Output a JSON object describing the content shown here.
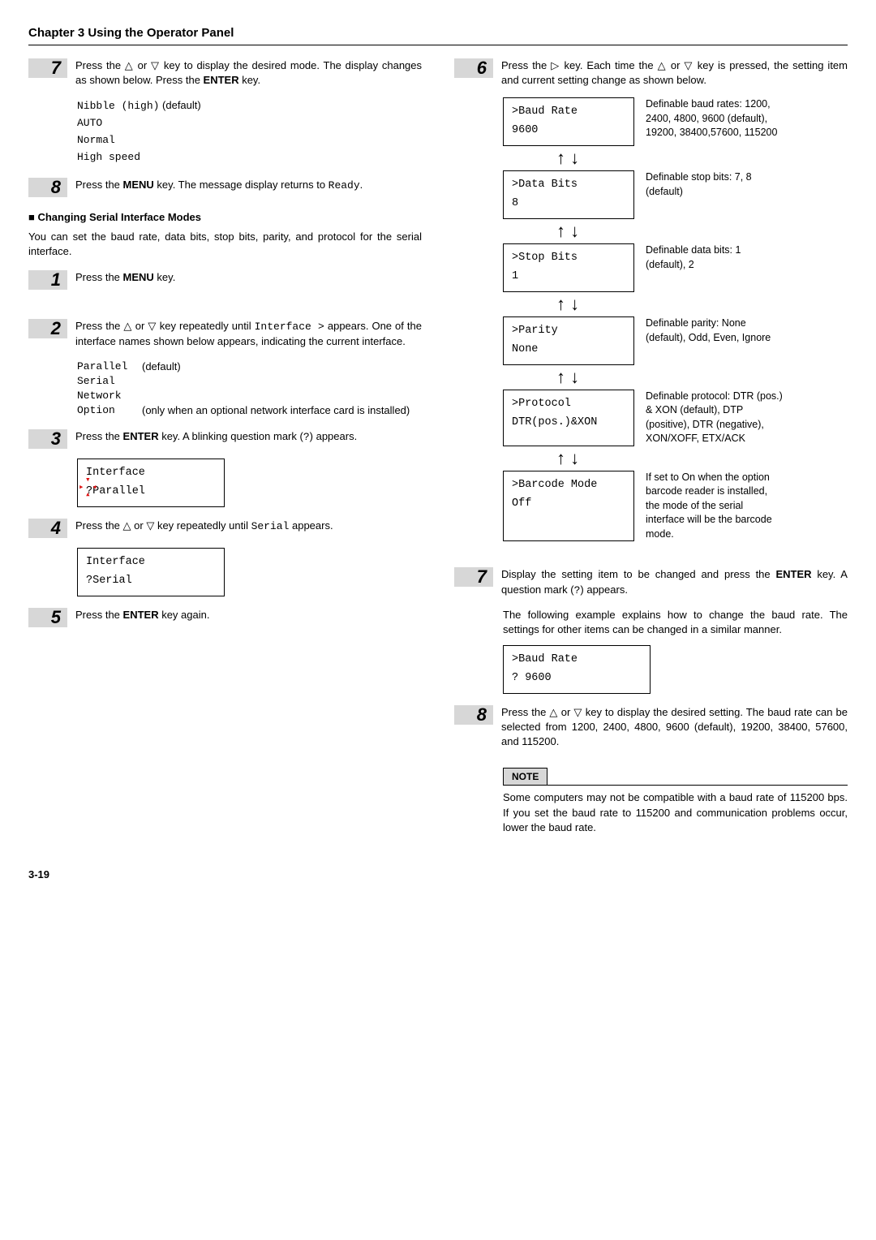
{
  "chapterTitle": "Chapter 3  Using the Operator Panel",
  "left": {
    "step7": {
      "textA": "Press the ",
      "textB": " or ",
      "textC": " key to display the desired mode. The display changes as shown below. Press the ",
      "enter": "ENTER",
      "textD": " key."
    },
    "modes": {
      "l1a": "Nibble (high)",
      "l1b": " (default)",
      "l2": "AUTO",
      "l3": "Normal",
      "l4": "High speed"
    },
    "step8": {
      "a": "Press the ",
      "menu": "MENU",
      "b": " key. The message display returns to ",
      "ready": "Ready",
      "c": "."
    },
    "sectionHead": "Changing Serial Interface Modes",
    "intro": "You can set the baud rate, data bits, stop bits, parity, and protocol for the serial interface.",
    "s1": {
      "a": "Press the ",
      "menu": "MENU",
      "b": " key."
    },
    "s2": {
      "a": "Press the ",
      "b": " or ",
      "c": " key repeatedly until ",
      "iface": "Interface  >",
      "d": " appears. One of the interface names shown below appears, indicating the current interface."
    },
    "iface": {
      "l1a": "Parallel",
      "l1b": " (default)",
      "l2": "Serial",
      "l3": "Network",
      "l4a": "Option",
      "l4b": "(only when an optional network interface card is installed)"
    },
    "s3": {
      "a": "Press the ",
      "enter": "ENTER",
      "b": " key. A blinking question mark (",
      "q": "?",
      "c": ") appears."
    },
    "box3": {
      "l1": "Interface",
      "l2": "?Parallel"
    },
    "s4": {
      "a": "Press the ",
      "b": " or ",
      "c": " key repeatedly until ",
      "serial": "Serial",
      "d": " appears."
    },
    "box4": {
      "l1": "Interface",
      "l2": "?Serial"
    },
    "s5": {
      "a": "Press the ",
      "enter": "ENTER",
      "b": " key again."
    }
  },
  "right": {
    "step6": {
      "a": "Press the ",
      "b": " key. Each time the ",
      "c": " or ",
      "d": " key is pressed, the setting item and current setting change as shown below."
    },
    "settings": [
      {
        "l1": ">Baud Rate",
        "l2": "  9600",
        "desc": "Definable baud rates: 1200, 2400, 4800, 9600 (default), 19200, 38400,57600, 115200"
      },
      {
        "l1": ">Data Bits",
        "l2": "  8",
        "desc": "Definable stop bits: 7, 8 (default)"
      },
      {
        "l1": ">Stop Bits",
        "l2": "  1",
        "desc": "Definable data bits: 1 (default), 2"
      },
      {
        "l1": ">Parity",
        "l2": "  None",
        "desc": "Definable parity: None (default), Odd, Even, Ignore"
      },
      {
        "l1": ">Protocol",
        "l2": "  DTR(pos.)&XON",
        "desc": "Definable protocol: DTR (pos.) & XON (default), DTP (positive), DTR (negative), XON/XOFF, ETX/ACK"
      },
      {
        "l1": ">Barcode Mode",
        "l2": "  Off",
        "desc": "If set to On when the option barcode reader is installed, the mode of the serial interface will be the barcode mode."
      }
    ],
    "step7": {
      "a": "Display the setting item to be changed and press the ",
      "enter": "ENTER",
      "b": " key. A question mark (",
      "q": "?",
      "c": ") appears."
    },
    "step7para": "The following example explains how to change the baud rate. The settings for other items can be changed in a similar manner.",
    "box7": {
      "l1": ">Baud Rate",
      "l2": "? 9600"
    },
    "step8": {
      "a": "Press the ",
      "b": " or ",
      "c": " key to display the desired setting. The baud rate can be selected from 1200, 2400, 4800, 9600 (default), 19200, 38400, 57600, and 115200."
    },
    "noteHead": "NOTE",
    "noteBody": "Some computers may not be compatible with a baud rate of 115200 bps. If you set the baud rate to 115200 and communication problems occur, lower the baud rate."
  },
  "pageNum": "3-19",
  "glyph": {
    "up": "△",
    "down": "▽",
    "right": "▷",
    "arrUp": "↑",
    "arrDown": "↓"
  }
}
